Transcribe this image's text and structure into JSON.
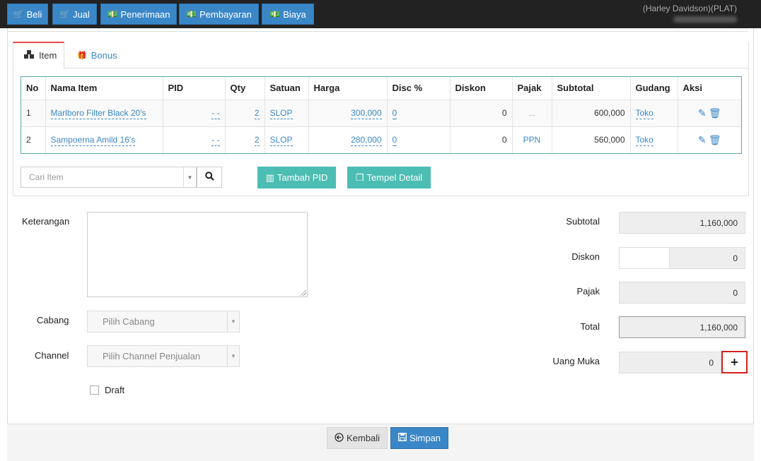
{
  "nav": {
    "buttons": [
      {
        "label": "Beli",
        "icon": "cart-icon"
      },
      {
        "label": "Jual",
        "icon": "cart-icon"
      },
      {
        "label": "Penerimaan",
        "icon": "money-icon"
      },
      {
        "label": "Pembayaran",
        "icon": "money-icon"
      },
      {
        "label": "Biaya",
        "icon": "money-icon"
      }
    ],
    "user": "(Harley Davidson)(PLAT)"
  },
  "tabs": [
    {
      "label": "Item",
      "icon": "cubes-icon",
      "active": true
    },
    {
      "label": "Bonus",
      "icon": "gift-icon",
      "active": false
    }
  ],
  "table": {
    "headers": [
      "No",
      "Nama Item",
      "PID",
      "Qty",
      "Satuan",
      "Harga",
      "Disc %",
      "Diskon",
      "Pajak",
      "Subtotal",
      "Gudang",
      "Aksi"
    ],
    "rows": [
      {
        "no": "1",
        "name": "Marlboro Filter Black 20's",
        "pid": "- -",
        "qty": "2",
        "unit": "SLOP",
        "price": "300,000",
        "disc_pct": "0",
        "disc_pct_dash": "- -",
        "diskon": "0",
        "pajak": "...",
        "subtotal": "600,000",
        "gudang": "Toko"
      },
      {
        "no": "2",
        "name": "Sampoerna Amild 16's",
        "pid": "- -",
        "qty": "2",
        "unit": "SLOP",
        "price": "280,000",
        "disc_pct": "0",
        "disc_pct_dash": "- -",
        "diskon": "0",
        "pajak": "PPN",
        "subtotal": "560,000",
        "gudang": "Toko"
      }
    ]
  },
  "search": {
    "placeholder": "Cari Item"
  },
  "buttons": {
    "tambah_pid": "Tambah PID",
    "tempel_detail": "Tempel Detail",
    "kembali": "Kembali",
    "simpan": "Simpan"
  },
  "form": {
    "keterangan_label": "Keterangan",
    "cabang_label": "Cabang",
    "cabang_placeholder": "Pilih Cabang",
    "channel_label": "Channel",
    "channel_placeholder": "Pilih Channel Penjualan",
    "draft_label": "Draft"
  },
  "summary": {
    "subtotal_label": "Subtotal",
    "subtotal": "1,160,000",
    "diskon_label": "Diskon",
    "diskon": "0",
    "pajak_label": "Pajak",
    "pajak": "0",
    "total_label": "Total",
    "total": "1,160,000",
    "uang_muka_label": "Uang Muka",
    "uang_muka": "0",
    "plus": "+"
  },
  "colors": {
    "primary": "#3a87c8",
    "teal": "#4cbdb3",
    "highlight": "#d41f1f",
    "topbar": "#222222"
  }
}
